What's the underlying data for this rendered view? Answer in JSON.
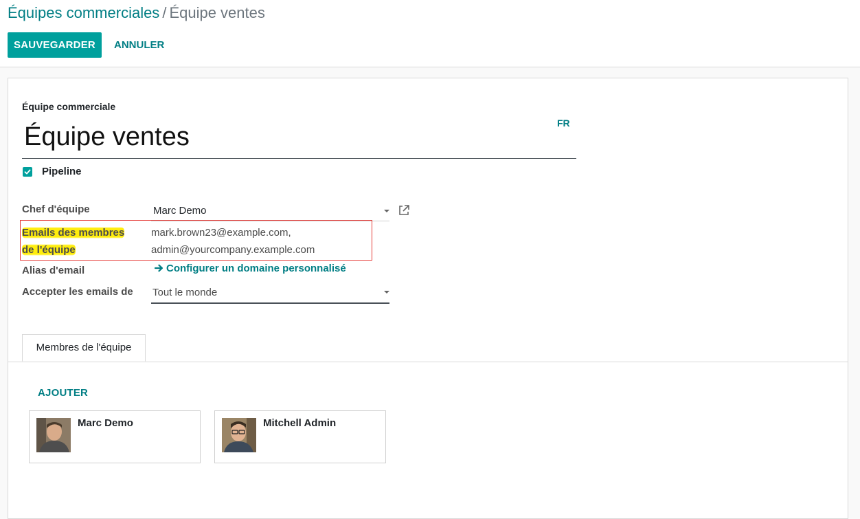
{
  "breadcrumb": {
    "parent": "Équipes commerciales",
    "separator": "/",
    "current": "Équipe ventes"
  },
  "toolbar": {
    "save_label": "SAUVEGARDER",
    "cancel_label": "ANNULER"
  },
  "form": {
    "name_label": "Équipe commerciale",
    "name_value": "Équipe ventes",
    "lang_button": "FR",
    "pipeline": {
      "label": "Pipeline",
      "checked": true
    },
    "team_leader": {
      "label": "Chef d'équipe",
      "value": "Marc Demo"
    },
    "member_emails": {
      "label_line1": "Emails des membres",
      "label_line2": "de l'équipe",
      "line1": "mark.brown23@example.com,",
      "line2": "admin@yourcompany.example.com"
    },
    "email_alias": {
      "label": "Alias d'email",
      "link_text": "Configurer un domaine personnalisé"
    },
    "accept_emails": {
      "label": "Accepter les emails de",
      "value": "Tout le monde"
    }
  },
  "tabs": [
    {
      "label": "Membres de l'équipe",
      "active": true
    }
  ],
  "members": {
    "add_label": "AJOUTER",
    "cards": [
      {
        "name": "Marc Demo"
      },
      {
        "name": "Mitchell Admin"
      }
    ]
  },
  "colors": {
    "primary": "#00a09d",
    "link": "#017e84",
    "highlight": "#ffec00",
    "annotation_box": "#e53935"
  },
  "icons": {
    "checkbox": "checkmark-icon",
    "dropdown": "caret-down-icon",
    "external": "external-link-icon",
    "alias_arrow": "arrow-right-icon"
  }
}
